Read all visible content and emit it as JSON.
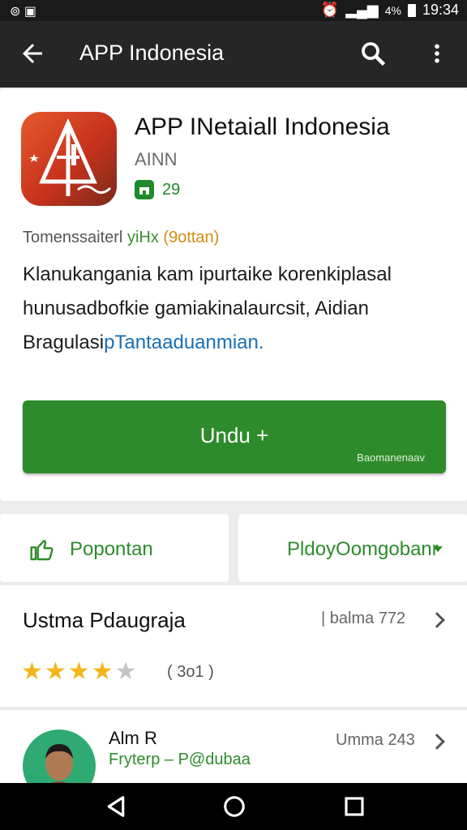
{
  "status_bar": {
    "left_icons": "⊚ ▣",
    "signal": "▂▄▆",
    "battery_text": "4%",
    "time": "19:34"
  },
  "app_bar": {
    "title": "APP Indonesia"
  },
  "app": {
    "name": "APP INetaiall Indonesia",
    "developer": "AINN",
    "badge_count": "29",
    "meta_prefix": "Tomenssaiterl",
    "meta_green": "yiHx",
    "meta_orange": "(9ottan)",
    "description_lines": [
      "Klanukangania kam ipurtaike korenkiplasal",
      "hunusadbofkie gamiakinalaurcsit, Aidian"
    ],
    "description_last_plain": "Bragulasi",
    "description_last_link": "pTantaaduanmian.",
    "install_label": "Undu +",
    "install_sub": "Baomanenaav"
  },
  "actions": {
    "left_label": "Popontan",
    "right_label": "PldoyOomgobanr"
  },
  "reviews": {
    "title": "Ustma Pdaugraja",
    "count_label": "| balma 772",
    "rating": 4,
    "max_rating": 5,
    "rating_count": "( 3o1 )"
  },
  "reviewer": {
    "name": "Alm R",
    "subtitle": "Fryterp – P@dubaa",
    "meta": "Umma 243"
  },
  "colors": {
    "accent_green": "#2e8b2b",
    "star": "#f2b51c",
    "app_bar": "#262626"
  }
}
